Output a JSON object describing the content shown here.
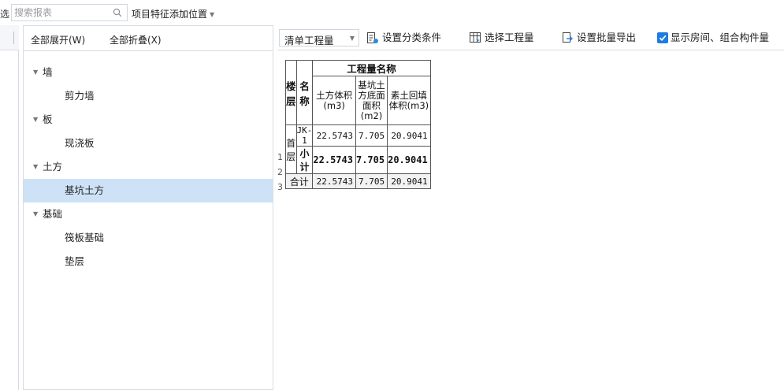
{
  "toolbar": {
    "cut_label": "选",
    "search_placeholder": "搜索报表",
    "feature_position_label": "项目特征添加位置"
  },
  "tree_panel": {
    "expand_all": "全部展开(W)",
    "collapse_all": "全部折叠(X)",
    "items": [
      {
        "label": "墙",
        "level": 0,
        "expanded": true
      },
      {
        "label": "剪力墙",
        "level": 1
      },
      {
        "label": "板",
        "level": 0,
        "expanded": true
      },
      {
        "label": "现浇板",
        "level": 1
      },
      {
        "label": "土方",
        "level": 0,
        "expanded": true
      },
      {
        "label": "基坑土方",
        "level": 1,
        "selected": true
      },
      {
        "label": "基础",
        "level": 0,
        "expanded": true
      },
      {
        "label": "筏板基础",
        "level": 1
      },
      {
        "label": "垫层",
        "level": 1
      }
    ]
  },
  "report_toolbar": {
    "quantity_type": "清单工程量",
    "set_category": "设置分类条件",
    "select_quantity": "选择工程量",
    "batch_export": "设置批量导出",
    "show_rooms_label": "显示房间、组合构件量",
    "show_rooms_checked": true
  },
  "table": {
    "header": {
      "floor": "楼层",
      "name": "名称",
      "group": "工程量名称",
      "col1": "土方体积(m3)",
      "col2": "基坑土方底面面积(m2)",
      "col3": "素土回填体积(m3)"
    },
    "row_numbers": [
      "1",
      "2",
      "3"
    ],
    "rows": [
      {
        "floor": "首层",
        "name": "JK-1",
        "v1": "22.5743",
        "v2": "7.705",
        "v3": "20.9041"
      },
      {
        "name": "小计",
        "v1": "22.5743",
        "v2": "7.705",
        "v3": "20.9041"
      }
    ],
    "total": {
      "label": "合计",
      "v1": "22.5743",
      "v2": "7.705",
      "v3": "20.9041"
    }
  },
  "colors": {
    "selected_row": "#cde2f6",
    "check_blue": "#1e7ce0",
    "border": "#d6dbe3"
  }
}
